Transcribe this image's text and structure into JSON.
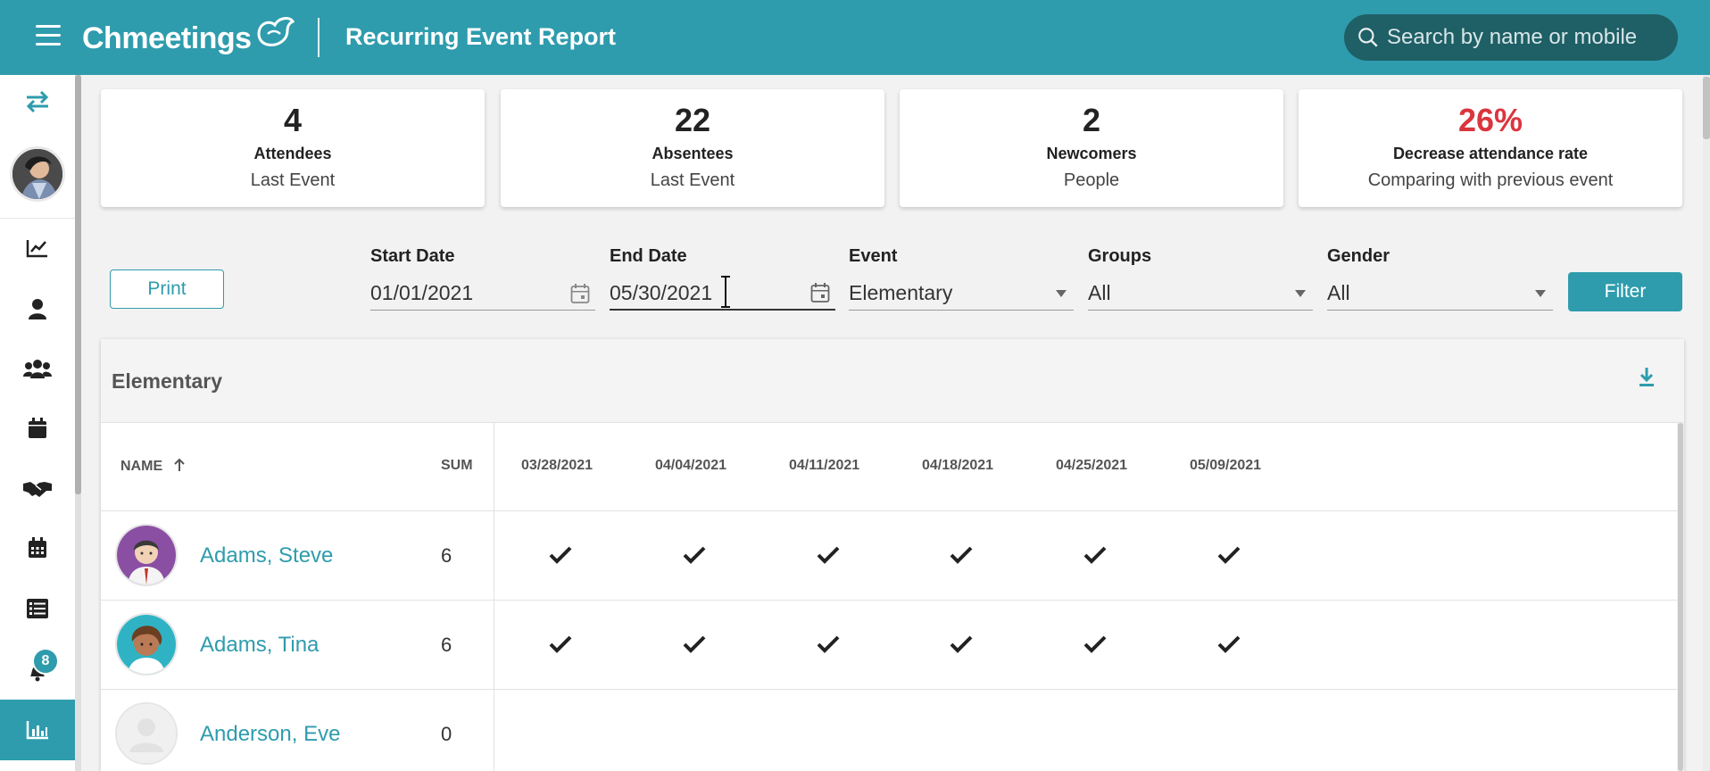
{
  "header": {
    "logo_text": "Chmeetings",
    "page_title": "Recurring Event Report",
    "search_placeholder": "Search by name or mobile"
  },
  "sidebar": {
    "notification_count": "8",
    "items": [
      {
        "icon": "chart-line-icon"
      },
      {
        "icon": "person-icon"
      },
      {
        "icon": "people-group-icon"
      },
      {
        "icon": "calendar-icon"
      },
      {
        "icon": "handshake-icon"
      },
      {
        "icon": "calendar-grid-icon"
      },
      {
        "icon": "list-icon"
      },
      {
        "icon": "bell-icon"
      },
      {
        "icon": "bar-chart-icon",
        "active": true
      }
    ]
  },
  "stats": [
    {
      "value": "4",
      "label": "Attendees",
      "sub": "Last Event"
    },
    {
      "value": "22",
      "label": "Absentees",
      "sub": "Last Event"
    },
    {
      "value": "2",
      "label": "Newcomers",
      "sub": "People"
    },
    {
      "value": "26%",
      "label": "Decrease attendance rate",
      "sub": "Comparing with previous event",
      "color": "#d9363e"
    }
  ],
  "filters": {
    "print_label": "Print",
    "start_date": {
      "label": "Start Date",
      "value": "01/01/2021"
    },
    "end_date": {
      "label": "End Date",
      "value": "05/30/2021"
    },
    "event": {
      "label": "Event",
      "value": "Elementary"
    },
    "groups": {
      "label": "Groups",
      "value": "All"
    },
    "gender": {
      "label": "Gender",
      "value": "All"
    },
    "filter_label": "Filter"
  },
  "table": {
    "title": "Elementary",
    "columns": {
      "name": "NAME",
      "sum": "SUM"
    },
    "dates": [
      "03/28/2021",
      "04/04/2021",
      "04/11/2021",
      "04/18/2021",
      "04/25/2021",
      "05/09/2021"
    ],
    "rows": [
      {
        "name": "Adams, Steve",
        "sum": "6",
        "attendance": [
          true,
          true,
          true,
          true,
          true,
          true
        ]
      },
      {
        "name": "Adams, Tina",
        "sum": "6",
        "attendance": [
          true,
          true,
          true,
          true,
          true,
          true
        ]
      },
      {
        "name": "Anderson, Eve",
        "sum": "0",
        "attendance": [
          false,
          false,
          false,
          false,
          false,
          false
        ]
      }
    ]
  },
  "colors": {
    "accent": "#2e9cad",
    "negative": "#d9363e"
  }
}
